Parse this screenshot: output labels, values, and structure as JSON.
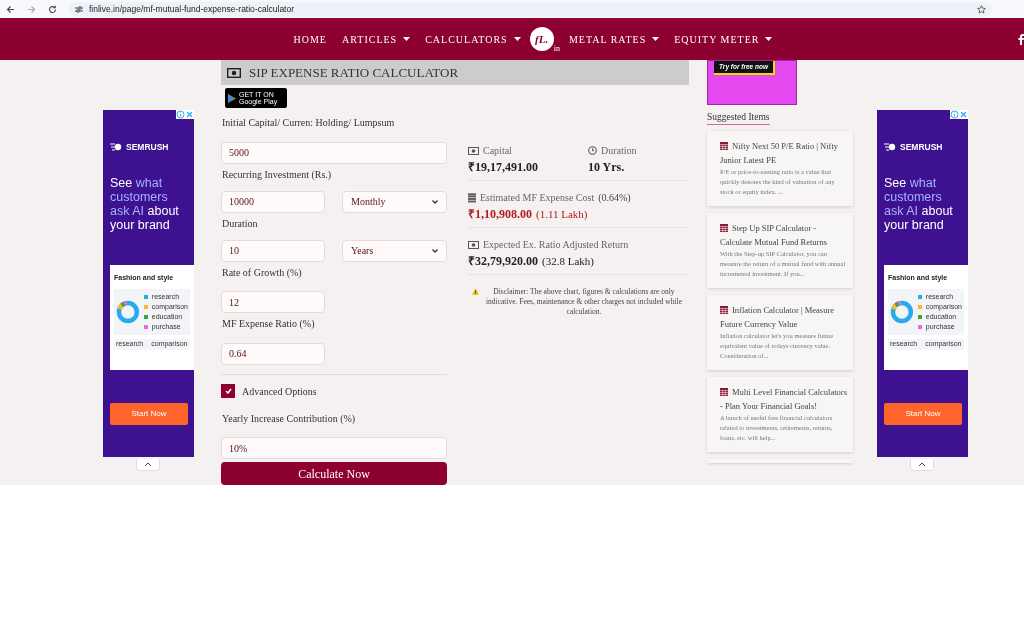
{
  "browser": {
    "url": "finlive.in/page/mf-mutual-fund-expense-ratio-calculator"
  },
  "nav": {
    "items": [
      {
        "label": "HOME",
        "kind": "link"
      },
      {
        "label": "ARTICLES",
        "kind": "dropdown"
      },
      {
        "label": "CALCULATORS",
        "kind": "dropdown"
      }
    ],
    "items_right": [
      {
        "label": "METAL RATES",
        "kind": "dropdown"
      },
      {
        "label": "EQUITY METER",
        "kind": "dropdown"
      }
    ],
    "logo": {
      "text": "fL.",
      "suffix": "in"
    }
  },
  "ads": [
    {
      "brand": "SEMRUSH",
      "headline": [
        {
          "text": "See ",
          "highlight": false
        },
        {
          "text": "what customers ask AI",
          "highlight": true
        },
        {
          "text": " about your brand",
          "highlight": false
        }
      ],
      "card_title": "Fashion and style",
      "legend": [
        {
          "label": "research",
          "color": "#29a9f0"
        },
        {
          "label": "comparison",
          "color": "#f7b924"
        },
        {
          "label": "education",
          "color": "#3aa635"
        },
        {
          "label": "purchase",
          "color": "#f06ad8"
        }
      ],
      "columns": [
        "research",
        "comparison"
      ],
      "button": "Start Now"
    },
    {
      "brand": "SEMRUSH",
      "headline": [
        {
          "text": "See ",
          "highlight": false
        },
        {
          "text": "what customers ask AI",
          "highlight": true
        },
        {
          "text": " about your brand",
          "highlight": false
        }
      ],
      "card_title": "Fashion and style",
      "legend": [
        {
          "label": "research",
          "color": "#29a9f0"
        },
        {
          "label": "comparison",
          "color": "#f7b924"
        },
        {
          "label": "education",
          "color": "#3aa635"
        },
        {
          "label": "purchase",
          "color": "#f06ad8"
        }
      ],
      "columns": [
        "research",
        "comparison"
      ],
      "button": "Start Now"
    }
  ],
  "top_ad": {
    "button": "Try for free now"
  },
  "calculator": {
    "title": "SIP EXPENSE RATIO CALCULATOR",
    "store_badge": {
      "small": "GET IT ON",
      "big": "Google Play"
    },
    "fields": [
      {
        "label": "Initial Capital/ Curren: Holding/ Lumpsum",
        "value": "5000"
      },
      {
        "label": "Recurring Investment (Rs.)",
        "value": "10000",
        "select": "Monthly"
      },
      {
        "label": "Duration",
        "value": "10",
        "select": "Years"
      },
      {
        "label": "Rate of Growth (%)",
        "value": "12"
      },
      {
        "label": "MF Expense Ratio (%)",
        "value": "0.64"
      }
    ],
    "advanced": {
      "label": "Advanced Options",
      "checked": true
    },
    "advanced_fields": [
      {
        "label": "Yearly Increase Contribution (%)",
        "value": "10%"
      }
    ],
    "button": "Calculate Now"
  },
  "results": {
    "capital": {
      "label": "Capital",
      "value": "₹19,17,491.00"
    },
    "duration": {
      "label": "Duration",
      "value": "10 Yrs."
    },
    "expense": {
      "label": "Estimated MF Expense Cost",
      "note": "(0.64%)",
      "value": "₹1,10,908.00",
      "lakh": "(1.11 Lakh)"
    },
    "return": {
      "label": "Expected Ex. Ratio Adjusted Return",
      "value": "₹32,79,920.00",
      "lakh": "(32.8 Lakh)"
    },
    "disclaimer": "Disclaimer: The above chart, figures & calculations are only indicative. Fees, maintenance & other charges not included while calculation."
  },
  "suggested": {
    "title": "Suggested Items",
    "items": [
      {
        "title": "Nifty Next 50 P/E Ratio | Nifty Junior Latest PE",
        "text": "P/E or price-to-earning ratio is a value that quickly denotes the kind of valuation of any stock or equity index. ..."
      },
      {
        "title": "Step Up SIP Calculator - Calculate Mutual Fund Returns",
        "text": "With the Step-up SIP Calculator, you can measure the return of a mutual fund with annual incremental investment. If you..."
      },
      {
        "title": "Inflation Calculator | Measure Future Currency Value",
        "text": "Inflation calculator let's you measure future equivalent value of todays currency value. Consideration of..."
      },
      {
        "title": "Multi Level Financial Calculators - Plan Your Financial Goals!",
        "text": "A bunch of useful free financial calculators related to investments, retirements, returns, loans, etc. will help..."
      }
    ]
  }
}
